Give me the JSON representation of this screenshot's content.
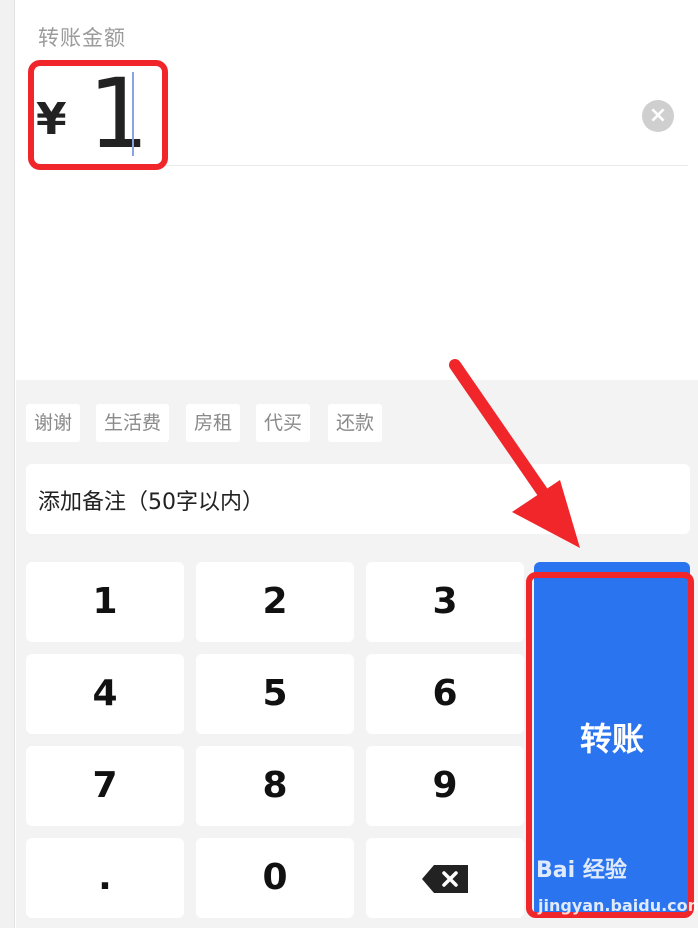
{
  "amount": {
    "label": "转账金额",
    "currency_symbol": "¥",
    "value": "1",
    "clear_icon": "clear-circle-icon"
  },
  "remark": {
    "quick_tags": [
      "谢谢",
      "生活费",
      "房租",
      "代买",
      "还款"
    ],
    "placeholder": "添加备注（50字以内）"
  },
  "keypad": {
    "keys": [
      "1",
      "2",
      "3",
      "4",
      "5",
      "6",
      "7",
      "8",
      "9",
      ".",
      "0"
    ],
    "backspace_icon": "backspace-icon",
    "submit_label": "转账"
  },
  "annotation": {
    "highlight_color": "#f0262a",
    "accent_color": "#2b74f0"
  },
  "watermark": {
    "brand": "Bai  经验",
    "url": "jingyan.baidu.com"
  }
}
